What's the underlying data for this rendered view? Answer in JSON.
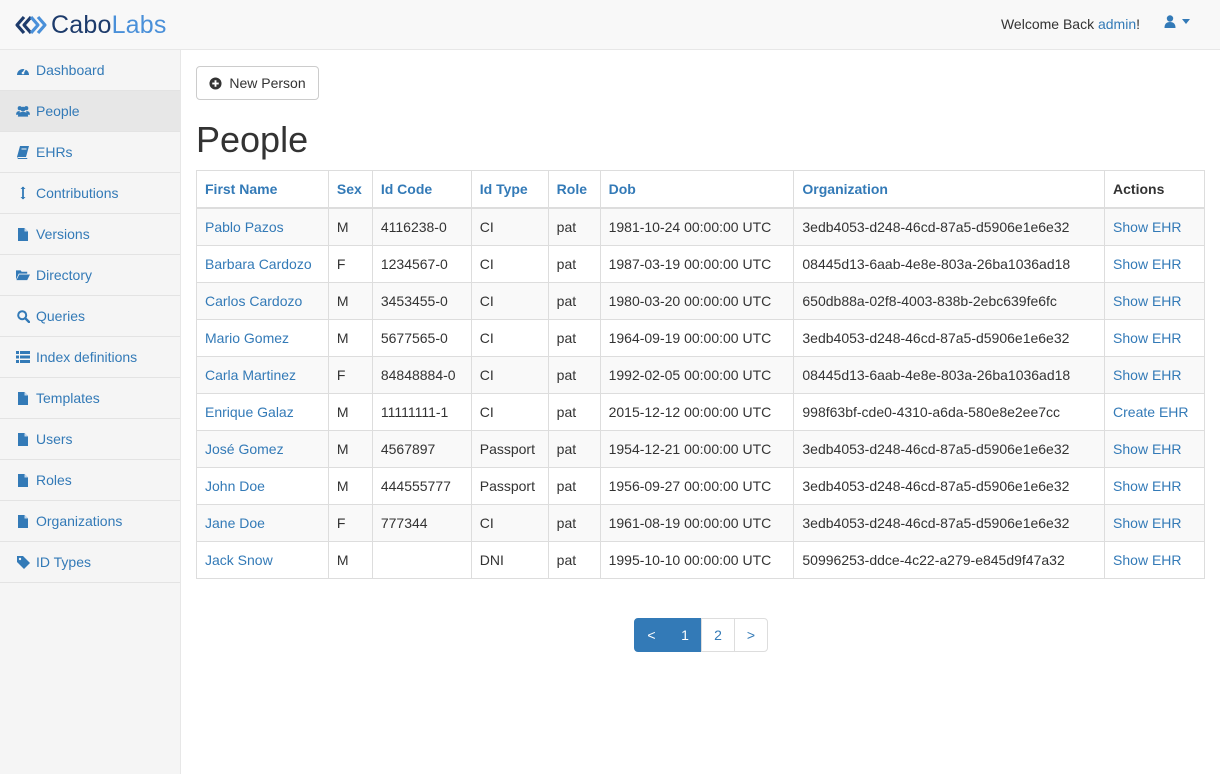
{
  "brand": {
    "part1": "Cabo",
    "part2": "Labs"
  },
  "header": {
    "welcome_prefix": "Welcome Back ",
    "username": "admin",
    "welcome_suffix": "!"
  },
  "sidebar": {
    "items": [
      {
        "label": "Dashboard",
        "icon": "dashboard-icon"
      },
      {
        "label": "People",
        "icon": "users-icon",
        "active": true
      },
      {
        "label": "EHRs",
        "icon": "book-icon"
      },
      {
        "label": "Contributions",
        "icon": "text-height-icon"
      },
      {
        "label": "Versions",
        "icon": "file-icon"
      },
      {
        "label": "Directory",
        "icon": "folder-open-icon"
      },
      {
        "label": "Queries",
        "icon": "search-icon"
      },
      {
        "label": "Index definitions",
        "icon": "list-icon"
      },
      {
        "label": "Templates",
        "icon": "file-icon"
      },
      {
        "label": "Users",
        "icon": "file-icon"
      },
      {
        "label": "Roles",
        "icon": "file-icon"
      },
      {
        "label": "Organizations",
        "icon": "file-icon"
      },
      {
        "label": "ID Types",
        "icon": "tag-icon"
      }
    ]
  },
  "main": {
    "new_button": "New Person",
    "title": "People",
    "table": {
      "headers": [
        "First Name",
        "Sex",
        "Id Code",
        "Id Type",
        "Role",
        "Dob",
        "Organization",
        "Actions"
      ],
      "rows": [
        [
          "Pablo Pazos",
          "M",
          "4116238-0",
          "CI",
          "pat",
          "1981-10-24 00:00:00 UTC",
          "3edb4053-d248-46cd-87a5-d5906e1e6e32",
          "Show EHR"
        ],
        [
          "Barbara Cardozo",
          "F",
          "1234567-0",
          "CI",
          "pat",
          "1987-03-19 00:00:00 UTC",
          "08445d13-6aab-4e8e-803a-26ba1036ad18",
          "Show EHR"
        ],
        [
          "Carlos Cardozo",
          "M",
          "3453455-0",
          "CI",
          "pat",
          "1980-03-20 00:00:00 UTC",
          "650db88a-02f8-4003-838b-2ebc639fe6fc",
          "Show EHR"
        ],
        [
          "Mario Gomez",
          "M",
          "5677565-0",
          "CI",
          "pat",
          "1964-09-19 00:00:00 UTC",
          "3edb4053-d248-46cd-87a5-d5906e1e6e32",
          "Show EHR"
        ],
        [
          "Carla Martinez",
          "F",
          "84848884-0",
          "CI",
          "pat",
          "1992-02-05 00:00:00 UTC",
          "08445d13-6aab-4e8e-803a-26ba1036ad18",
          "Show EHR"
        ],
        [
          "Enrique Galaz",
          "M",
          "11111111-1",
          "CI",
          "pat",
          "2015-12-12 00:00:00 UTC",
          "998f63bf-cde0-4310-a6da-580e8e2ee7cc",
          "Create EHR"
        ],
        [
          "José Gomez",
          "M",
          "4567897",
          "Passport",
          "pat",
          "1954-12-21 00:00:00 UTC",
          "3edb4053-d248-46cd-87a5-d5906e1e6e32",
          "Show EHR"
        ],
        [
          "John Doe",
          "M",
          "444555777",
          "Passport",
          "pat",
          "1956-09-27 00:00:00 UTC",
          "3edb4053-d248-46cd-87a5-d5906e1e6e32",
          "Show EHR"
        ],
        [
          "Jane Doe",
          "F",
          "777344",
          "CI",
          "pat",
          "1961-08-19 00:00:00 UTC",
          "3edb4053-d248-46cd-87a5-d5906e1e6e32",
          "Show EHR"
        ],
        [
          "Jack Snow",
          "M",
          "",
          "DNI",
          "pat",
          "1995-10-10 00:00:00 UTC",
          "50996253-ddce-4c22-a279-e845d9f47a32",
          "Show EHR"
        ]
      ]
    },
    "pagination": {
      "prev": "<",
      "pages": [
        "1",
        "2"
      ],
      "current": "1",
      "next": ">"
    }
  },
  "colors": {
    "link": "#337ab7",
    "brand_dark": "#1d3b6b",
    "brand_light": "#4a90d9"
  }
}
